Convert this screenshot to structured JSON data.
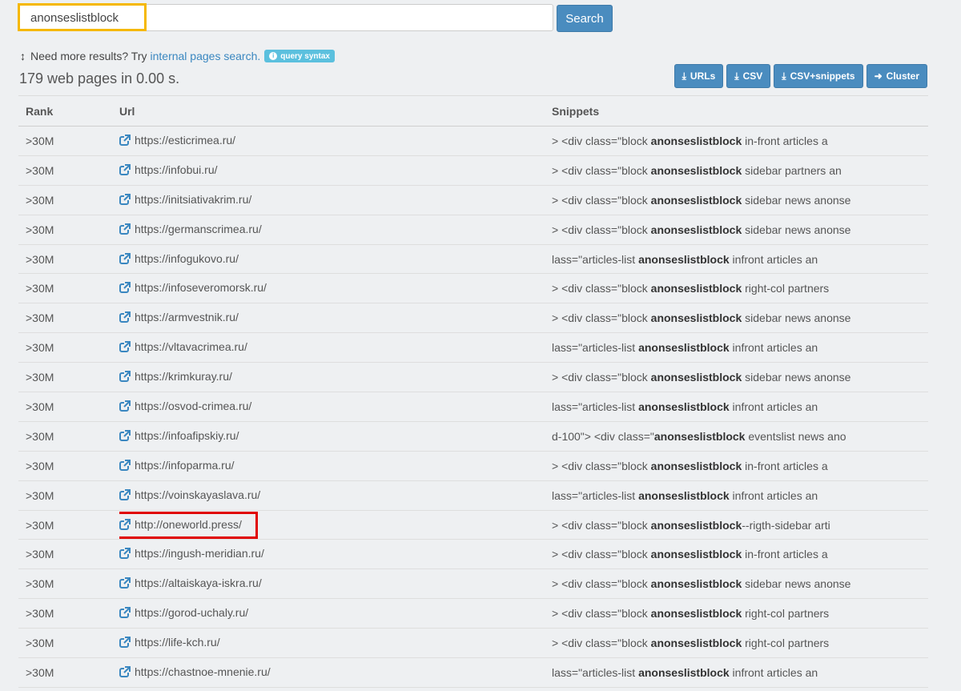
{
  "search": {
    "query": "anonseslistblock",
    "button_label": "Search"
  },
  "info": {
    "prefix": "Need more results? Try",
    "link_text": "internal pages search.",
    "badge_text": "query syntax"
  },
  "result_count": "179 web pages in 0.00 s.",
  "export_buttons": [
    {
      "label": "URLs",
      "icon": "download-icon"
    },
    {
      "label": "CSV",
      "icon": "download-icon"
    },
    {
      "label": "CSV+snippets",
      "icon": "download-icon"
    },
    {
      "label": "Cluster",
      "icon": "arrow-right-icon"
    }
  ],
  "table": {
    "headers": {
      "rank": "Rank",
      "url": "Url",
      "snippets": "Snippets"
    },
    "rows": [
      {
        "rank": ">30M",
        "url": "https://esticrimea.ru/",
        "snippet_pre": "> <div class=\"block ",
        "snippet_bold": "anonseslistblock",
        "snippet_post": " in-front articles a"
      },
      {
        "rank": ">30M",
        "url": "https://infobui.ru/",
        "snippet_pre": "> <div class=\"block ",
        "snippet_bold": "anonseslistblock",
        "snippet_post": " sidebar partners an"
      },
      {
        "rank": ">30M",
        "url": "https://initsiativakrim.ru/",
        "snippet_pre": "> <div class=\"block ",
        "snippet_bold": "anonseslistblock",
        "snippet_post": " sidebar news anonse"
      },
      {
        "rank": ">30M",
        "url": "https://germanscrimea.ru/",
        "snippet_pre": "> <div class=\"block ",
        "snippet_bold": "anonseslistblock",
        "snippet_post": " sidebar news anonse"
      },
      {
        "rank": ">30M",
        "url": "https://infogukovo.ru/",
        "snippet_pre": "lass=\"articles-list ",
        "snippet_bold": "anonseslistblock",
        "snippet_post": " infront articles an"
      },
      {
        "rank": ">30M",
        "url": "https://infoseveromorsk.ru/",
        "snippet_pre": "> <div class=\"block ",
        "snippet_bold": "anonseslistblock",
        "snippet_post": " right-col partners"
      },
      {
        "rank": ">30M",
        "url": "https://armvestnik.ru/",
        "snippet_pre": "> <div class=\"block ",
        "snippet_bold": "anonseslistblock",
        "snippet_post": " sidebar news anonse"
      },
      {
        "rank": ">30M",
        "url": "https://vltavacrimea.ru/",
        "snippet_pre": "lass=\"articles-list ",
        "snippet_bold": "anonseslistblock",
        "snippet_post": " infront articles an"
      },
      {
        "rank": ">30M",
        "url": "https://krimkuray.ru/",
        "snippet_pre": "> <div class=\"block ",
        "snippet_bold": "anonseslistblock",
        "snippet_post": " sidebar news anonse"
      },
      {
        "rank": ">30M",
        "url": "https://osvod-crimea.ru/",
        "snippet_pre": "lass=\"articles-list ",
        "snippet_bold": "anonseslistblock",
        "snippet_post": " infront articles an"
      },
      {
        "rank": ">30M",
        "url": "https://infoafipskiy.ru/",
        "snippet_pre": "d-100\"> <div class=\"",
        "snippet_bold": "anonseslistblock",
        "snippet_post": " eventslist news ano"
      },
      {
        "rank": ">30M",
        "url": "https://infoparma.ru/",
        "snippet_pre": "> <div class=\"block ",
        "snippet_bold": "anonseslistblock",
        "snippet_post": " in-front articles a"
      },
      {
        "rank": ">30M",
        "url": "https://voinskayaslava.ru/",
        "snippet_pre": "lass=\"articles-list ",
        "snippet_bold": "anonseslistblock",
        "snippet_post": " infront articles an"
      },
      {
        "rank": ">30M",
        "url": "http://oneworld.press/",
        "snippet_pre": "> <div class=\"block ",
        "snippet_bold": "anonseslistblock",
        "snippet_post": "--rigth-sidebar arti",
        "highlighted": true
      },
      {
        "rank": ">30M",
        "url": "https://ingush-meridian.ru/",
        "snippet_pre": "> <div class=\"block ",
        "snippet_bold": "anonseslistblock",
        "snippet_post": " in-front articles a"
      },
      {
        "rank": ">30M",
        "url": "https://altaiskaya-iskra.ru/",
        "snippet_pre": "> <div class=\"block ",
        "snippet_bold": "anonseslistblock",
        "snippet_post": " sidebar news anonse"
      },
      {
        "rank": ">30M",
        "url": "https://gorod-uchaly.ru/",
        "snippet_pre": "> <div class=\"block ",
        "snippet_bold": "anonseslistblock",
        "snippet_post": " right-col partners"
      },
      {
        "rank": ">30M",
        "url": "https://life-kch.ru/",
        "snippet_pre": "> <div class=\"block ",
        "snippet_bold": "anonseslistblock",
        "snippet_post": " right-col partners"
      },
      {
        "rank": ">30M",
        "url": "https://chastnoe-mnenie.ru/",
        "snippet_pre": "lass=\"articles-list ",
        "snippet_bold": "anonseslistblock",
        "snippet_post": " infront articles an"
      }
    ]
  },
  "colors": {
    "accent": "#4a8cbf",
    "badge": "#5bc0de",
    "highlight_yellow": "#f5b800",
    "highlight_red": "#e00000"
  }
}
